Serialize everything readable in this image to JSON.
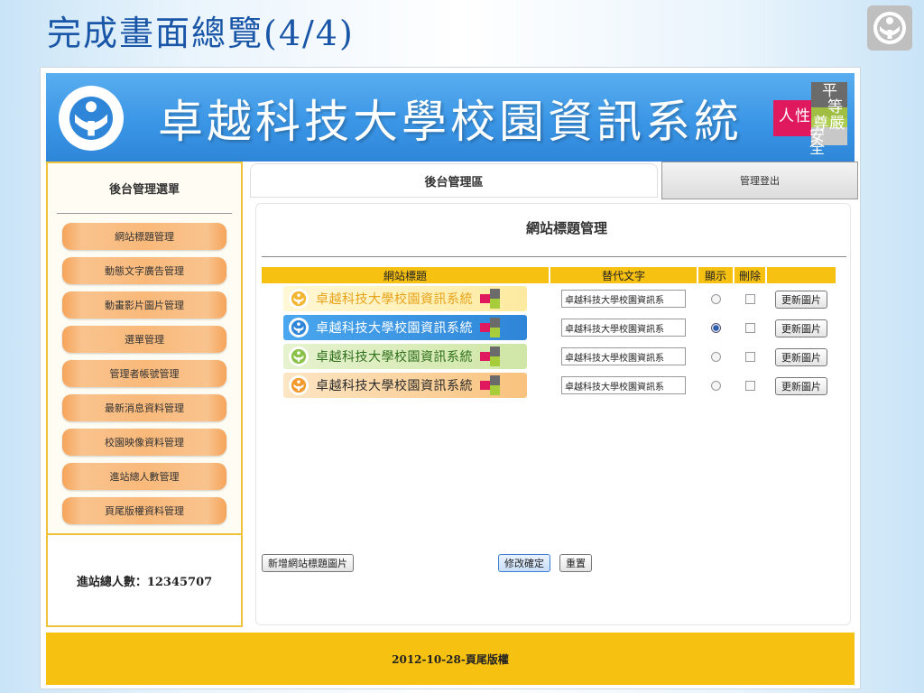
{
  "slide": {
    "title": "完成畫面總覽(4/4)"
  },
  "banner": {
    "title": "卓越科技大學校園資訊系統",
    "motto": [
      "平",
      "等",
      "人",
      "性",
      "尊",
      "嚴",
      "安",
      "全"
    ]
  },
  "sidebar": {
    "header": "後台管理選單",
    "items": [
      {
        "label": "網站標題管理"
      },
      {
        "label": "動態文字廣告管理"
      },
      {
        "label": "動畫影片圖片管理"
      },
      {
        "label": "選單管理"
      },
      {
        "label": "管理者帳號管理"
      },
      {
        "label": "最新消息資料管理"
      },
      {
        "label": "校園映像資料管理"
      },
      {
        "label": "進站總人數管理"
      },
      {
        "label": "頁尾版權資料管理"
      }
    ],
    "visitor_count": "進站總人數：12345707"
  },
  "top": {
    "main_tab": "後台管理區",
    "logout": "管理登出"
  },
  "content": {
    "title": "網站標題管理",
    "columns": {
      "image": "網站標題",
      "alt": "替代文字",
      "show": "顯示",
      "delete": "刪除"
    },
    "rows": [
      {
        "image_text": "卓越科技大學校園資訊系統",
        "alt_value": "卓越科技大學校園資訊系",
        "shown": false,
        "delete": false,
        "update_label": "更新圖片",
        "theme": "yellow"
      },
      {
        "image_text": "卓越科技大學校園資訊系統",
        "alt_value": "卓越科技大學校園資訊系",
        "shown": true,
        "delete": false,
        "update_label": "更新圖片",
        "theme": "blue"
      },
      {
        "image_text": "卓越科技大學校園資訊系統",
        "alt_value": "卓越科技大學校園資訊系",
        "shown": false,
        "delete": false,
        "update_label": "更新圖片",
        "theme": "green"
      },
      {
        "image_text": "卓越科技大學校園資訊系統",
        "alt_value": "卓越科技大學校園資訊系",
        "shown": false,
        "delete": false,
        "update_label": "更新圖片",
        "theme": "orange"
      }
    ],
    "add_button": "新增網站標題圖片",
    "confirm_button": "修改確定",
    "reset_button": "重置"
  },
  "footer": {
    "text": "2012-10-28-頁尾版權"
  },
  "colors": {
    "banner_blue": "#3b96e6",
    "accent_yellow": "#f7c112",
    "menu_orange": "#f9b97a",
    "title_blue": "#1a56a8"
  }
}
